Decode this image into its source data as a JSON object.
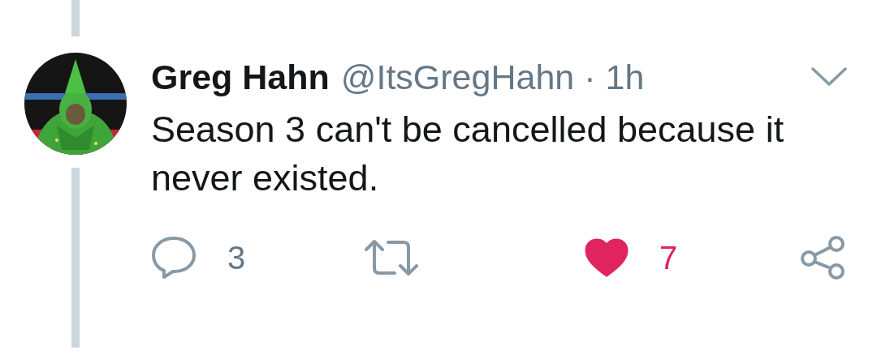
{
  "tweet": {
    "author_name": "Greg Hahn",
    "handle": "@ItsGregHahn",
    "separator": "·",
    "time": "1h",
    "text": "Season 3 can't be cancelled because it never existed.",
    "actions": [
      {
        "kind": "reply",
        "count": "3"
      },
      {
        "kind": "retweet"
      },
      {
        "kind": "like",
        "count": "7",
        "liked": true
      },
      {
        "kind": "share"
      }
    ]
  }
}
